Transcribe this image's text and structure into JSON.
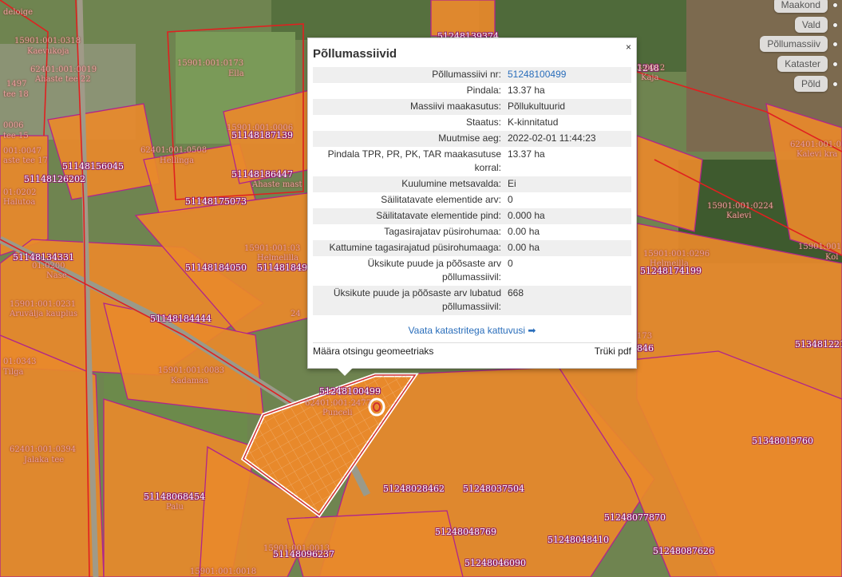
{
  "layers": [
    {
      "label": "Maakond"
    },
    {
      "label": "Vald"
    },
    {
      "label": "Põllumassiiv"
    },
    {
      "label": "Kataster"
    },
    {
      "label": "Põld"
    }
  ],
  "popup": {
    "title": "Põllumassiivid",
    "close": "×",
    "rows": [
      {
        "key": "Põllumassiivi nr:",
        "value": "51248100499",
        "link": true
      },
      {
        "key": "Pindala:",
        "value": "13.37 ha"
      },
      {
        "key": "Massiivi maakasutus:",
        "value": "Põllukultuurid"
      },
      {
        "key": "Staatus:",
        "value": "K-kinnitatud"
      },
      {
        "key": "Muutmise aeg:",
        "value": "2022-02-01 11:44:23"
      },
      {
        "key": "Pindala TPR, PR, PK, TAR maakasutuse korral:",
        "value": "13.37 ha"
      },
      {
        "key": "Kuulumine metsavalda:",
        "value": "Ei"
      },
      {
        "key": "Säilitatavate elementide arv:",
        "value": "0"
      },
      {
        "key": "Säilitatavate elementide pind:",
        "value": "0.000 ha"
      },
      {
        "key": "Tagasirajatav püsirohumaa:",
        "value": "0.00 ha"
      },
      {
        "key": "Kattumine tagasirajatud püsirohumaaga:",
        "value": "0.00 ha"
      },
      {
        "key": "Üksikute puude ja põõsaste arv põllumassiivil:",
        "value": "0"
      },
      {
        "key": "Üksikute puude ja põõsaste arv lubatud põllumassiivil:",
        "value": "668"
      }
    ],
    "overlap_link": "Vaata katastritega kattuvusi",
    "overlap_arrow": "arrow-right-icon",
    "footer_left": "Määra otsingu geomeetriaks",
    "footer_right": "Trüki pdf"
  },
  "map": {
    "colors": {
      "field": "#e8892b",
      "field_border": "#b0248c",
      "cadastre": "#e02020",
      "highlight": "#ffffff"
    },
    "field_labels": [
      "51248139374",
      "51148187139",
      "51148156045",
      "51148186447",
      "51148126202",
      "51148175073",
      "51148134331",
      "51148184050",
      "511481849",
      "51148184444",
      "51248174199",
      "513481221",
      "51348019760",
      "51248100499",
      "51248028462",
      "51248037504",
      "51148068454",
      "51248048769",
      "51248077870",
      "51248048410",
      "51248087626",
      "51148096237",
      "51248046090",
      "1248",
      "846"
    ],
    "cadastre_labels": [
      "15901:001:0318",
      "Kaevukoja",
      "62401:001:0019",
      "Ahaste tee 22",
      "tee 18",
      "1497",
      "15901:001:0173",
      "Ella",
      "0006",
      "tee 15",
      "001:0047",
      "aste tee 17",
      "62401:001:0508",
      "Hellinga",
      "15901:001:0006",
      "01:0202",
      "Halutoa",
      "Ahaste mast",
      "15901:001:03",
      "Helmelilla",
      "01:0200",
      "Nase",
      "15901:001:0231",
      "Aruvälja kauplus",
      "01:0343",
      "Tilga",
      "15901:001:0083",
      "Kadamaa",
      "62401:001:0394",
      "Jalaka tee",
      "Palu",
      "62401:001:2477",
      "Punceli",
      "15901:001:0224",
      "Kalevi",
      "62401:001:0",
      "Kalevi kra",
      "15901:001",
      "Kol",
      "15901:001:0296",
      "Helmeilla",
      "15901:001:0013",
      "15901:001:0018",
      "3:0012",
      "Kaja",
      "deloige",
      "173",
      "24"
    ]
  }
}
